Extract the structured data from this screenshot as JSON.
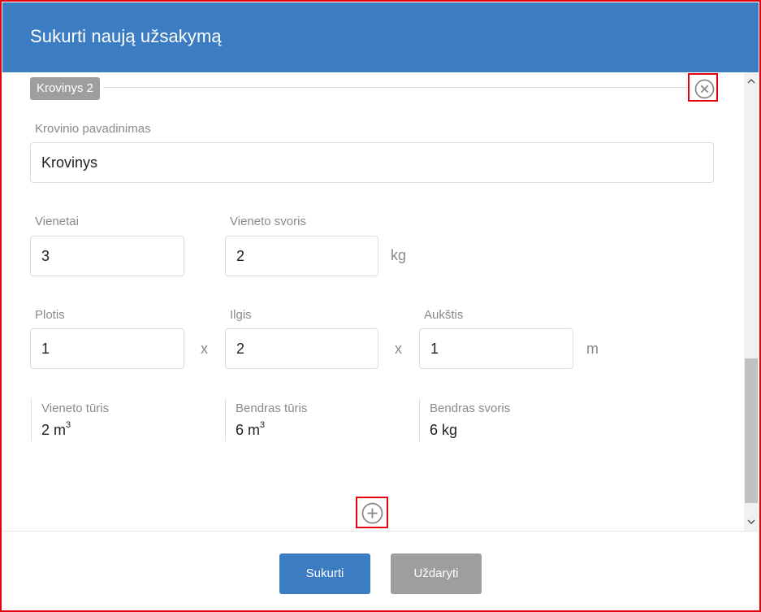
{
  "header": {
    "title": "Sukurti naują užsakymą"
  },
  "cargo": {
    "section_label": "Krovinys 2",
    "name": {
      "label": "Krovinio pavadinimas",
      "value": "Krovinys"
    },
    "units": {
      "label": "Vienetai",
      "value": "3"
    },
    "unit_weight": {
      "label": "Vieneto svoris",
      "value": "2",
      "unit": "kg"
    },
    "width": {
      "label": "Plotis",
      "value": "1"
    },
    "length": {
      "label": "Ilgis",
      "value": "2"
    },
    "height": {
      "label": "Aukštis",
      "value": "1",
      "unit": "m"
    },
    "multiply_sign_1": "x",
    "multiply_sign_2": "x",
    "unit_volume": {
      "label": "Vieneto tūris",
      "value": "2 m",
      "exponent": "3"
    },
    "total_volume": {
      "label": "Bendras tūris",
      "value": "6 m",
      "exponent": "3"
    },
    "total_weight": {
      "label": "Bendras svoris",
      "value": "6 kg"
    }
  },
  "footer": {
    "create_label": "Sukurti",
    "close_label": "Uždaryti"
  },
  "icons": {
    "remove": "close-circle-icon",
    "add": "plus-circle-icon"
  },
  "colors": {
    "header": "#3b7cc2",
    "primary_button": "#3b7cc2",
    "secondary_button": "#9e9e9e",
    "highlight": "#e3000f"
  }
}
